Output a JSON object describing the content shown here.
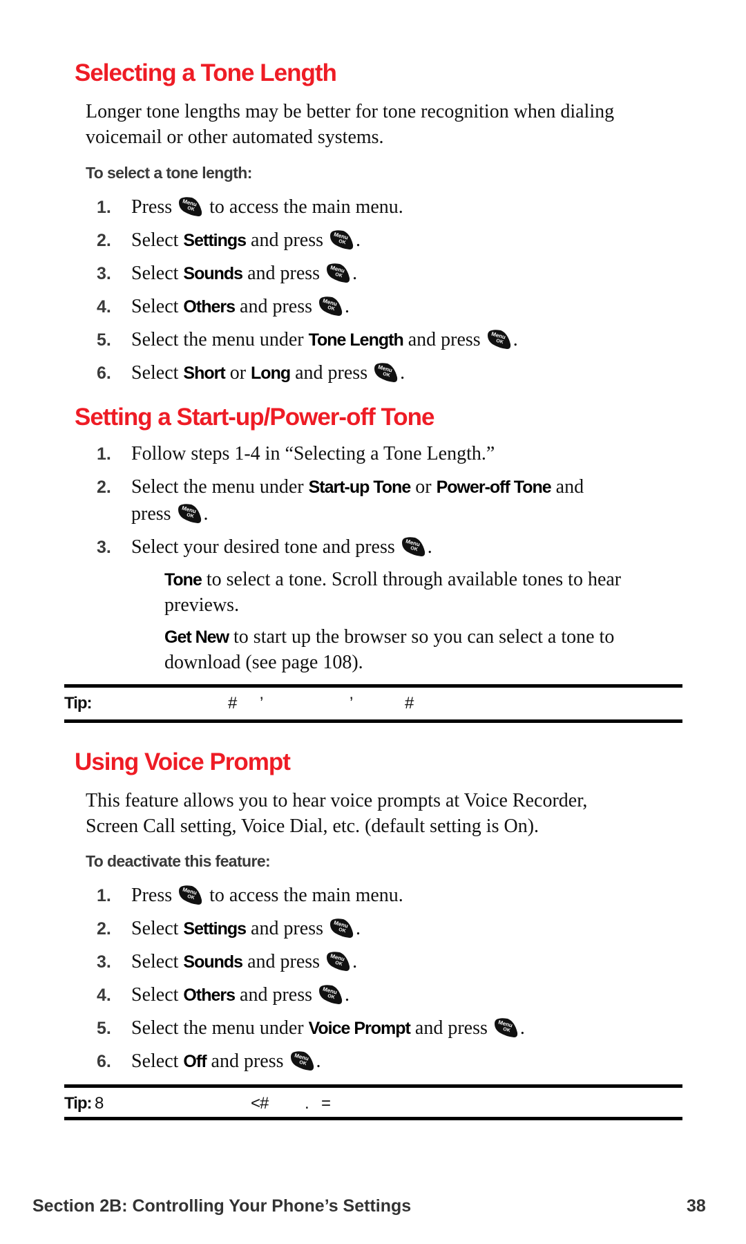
{
  "sections": [
    {
      "title": "Selecting a Tone Length",
      "intro": [
        "Longer tone lengths may be better for tone recognition when dialing",
        "voicemail or other automated systems."
      ],
      "subheading": "To select a tone length:",
      "steps": [
        {
          "num": "1.",
          "parts": [
            "Press ",
            "",
            " to access the main menu."
          ]
        },
        {
          "num": "2.",
          "pre": "Select ",
          "bold": "Settings",
          "post": " and press "
        },
        {
          "num": "3.",
          "pre": "Select ",
          "bold": "Sounds",
          "post": " and press "
        },
        {
          "num": "4.",
          "pre": "Select ",
          "bold": "Others",
          "post": " and press "
        },
        {
          "num": "5.",
          "pre": "Select the menu under ",
          "bold": "Tone Length",
          "post": " and press "
        },
        {
          "num": "6.",
          "pre": "Select ",
          "bold": "Short",
          "mid": " or ",
          "bold2": "Long",
          "post": " and press "
        }
      ]
    },
    {
      "title": "Setting a Start-up/Power-off Tone",
      "steps": [
        {
          "num": "1.",
          "text": "Follow steps 1-4 in “Selecting a Tone Length.”"
        },
        {
          "num": "2.",
          "pre": "Select the menu under ",
          "bold": "Start-up Tone",
          "mid": " or ",
          "bold2": "Power-off Tone",
          "post": " and",
          "line2": "press "
        },
        {
          "num": "3.",
          "pre": "Select your desired tone and press "
        }
      ],
      "options": [
        {
          "bold": "Tone",
          "text": " to select a tone. Scroll through available tones to hear",
          "line2": "previews."
        },
        {
          "bold": "Get New",
          "text": " to start up the browser so you can select a tone to",
          "line2": "download (see page 108)."
        }
      ],
      "tip": {
        "label": "Tip:",
        "glyphs": [
          "#",
          "’",
          "’",
          "#"
        ]
      }
    },
    {
      "title": "Using Voice Prompt",
      "intro": [
        "This feature allows you to hear voice prompts at Voice Recorder,",
        "Screen Call setting, Voice Dial, etc. (default setting is On)."
      ],
      "subheading": "To deactivate this feature:",
      "steps": [
        {
          "num": "1.",
          "parts": [
            "Press ",
            "",
            " to access the main menu."
          ]
        },
        {
          "num": "2.",
          "pre": "Select ",
          "bold": "Settings",
          "post": " and press "
        },
        {
          "num": "3.",
          "pre": "Select ",
          "bold": "Sounds",
          "post": " and press "
        },
        {
          "num": "4.",
          "pre": "Select ",
          "bold": "Others",
          "post": " and press "
        },
        {
          "num": "5.",
          "pre": "Select the menu under ",
          "bold": "Voice Prompt",
          "post": " and press "
        },
        {
          "num": "6.",
          "pre": "Select ",
          "bold": "Off",
          "post": " and press "
        }
      ],
      "tip": {
        "label": "Tip:",
        "glyphs": [
          "8",
          "<#",
          ".",
          "="
        ]
      }
    }
  ],
  "key_icon": {
    "name": "menu-ok-key",
    "line1": "Menu",
    "line2": "OK"
  },
  "period": ".",
  "footer": {
    "section": "Section 2B: Controlling Your Phone’s Settings",
    "page": "38"
  }
}
